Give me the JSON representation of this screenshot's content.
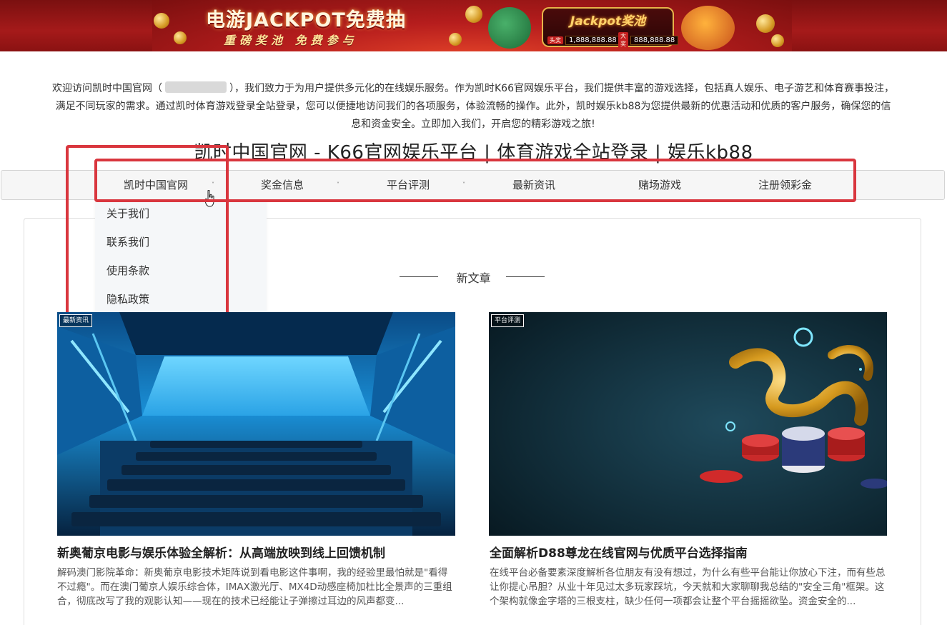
{
  "banner": {
    "title": "电游JACKPOT免费抽",
    "subtitle": "重磅奖池 免费参与",
    "pool_title": "Jackpot奖池",
    "pool_rows": [
      {
        "tag": "头奖",
        "value": "1,888,888.88"
      },
      {
        "tag": "大奖",
        "value": "888,888.88"
      }
    ]
  },
  "intro": {
    "before_link": "欢迎访问凯时中国官网（",
    "after_link": "），我们致力于为用户提供多元化的在线娱乐服务。作为凯时K66官网娱乐平台，我们提供丰富的游戏选择，包括真人娱乐、电子游艺和体育赛事投注，满足不同玩家的需求。通过凯时体育游戏登录全站登录，您可以便捷地访问我们的各项服务，体验流畅的操作。此外，凯时娱乐kb88为您提供最新的优惠活动和优质的客户服务，确保您的信息和资金安全。立即加入我们，开启您的精彩游戏之旅!"
  },
  "site_title": "凯时中国官网 - K66官网娱乐平台 | 体育游戏全站登录 | 娱乐kb88",
  "nav": {
    "items": [
      {
        "label": "凯时中国官网",
        "has_dropdown": true
      },
      {
        "label": "奖金信息",
        "has_dropdown": true
      },
      {
        "label": "平台评测",
        "has_dropdown": true
      },
      {
        "label": "最新资讯",
        "has_dropdown": false
      },
      {
        "label": "赌场游戏",
        "has_dropdown": false
      },
      {
        "label": "注册领彩金",
        "has_dropdown": false
      }
    ],
    "chevron": "˅",
    "dropdown": [
      "关于我们",
      "联系我们",
      "使用条款",
      "隐私政策"
    ]
  },
  "section": {
    "heading": "新文章"
  },
  "articles": [
    {
      "tag": "最新资讯",
      "title": "新奥葡京电影与娱乐体验全解析：从高端放映到线上回馈机制",
      "excerpt": "解码澳门影院革命：新奥葡京电影技术矩阵说到看电影这件事啊，我的经验里最怕就是\"看得不过瘾\"。而在澳门葡京人娱乐综合体，IMAX激光厅、MX4D动感座椅加杜比全景声的三重组合，彻底改写了我的观影认知——现在的技术已经能让子弹擦过耳边的风声都变..."
    },
    {
      "tag": "平台评测",
      "title": "全面解析D88尊龙在线官网与优质平台选择指南",
      "excerpt": "在线平台必备要素深度解析各位朋友有没有想过，为什么有些平台能让你放心下注，而有些总让你提心吊胆？从业十年见过太多玩家踩坑，今天就和大家聊聊我总结的\"安全三角\"框架。这个架构就像金字塔的三根支柱，缺少任何一项都会让整个平台摇摇欲坠。资金安全的..."
    }
  ],
  "colors": {
    "annotation_red": "#d9363e",
    "nav_bg": "#f6f6f6",
    "dropdown_bg": "#f5f7f9"
  }
}
